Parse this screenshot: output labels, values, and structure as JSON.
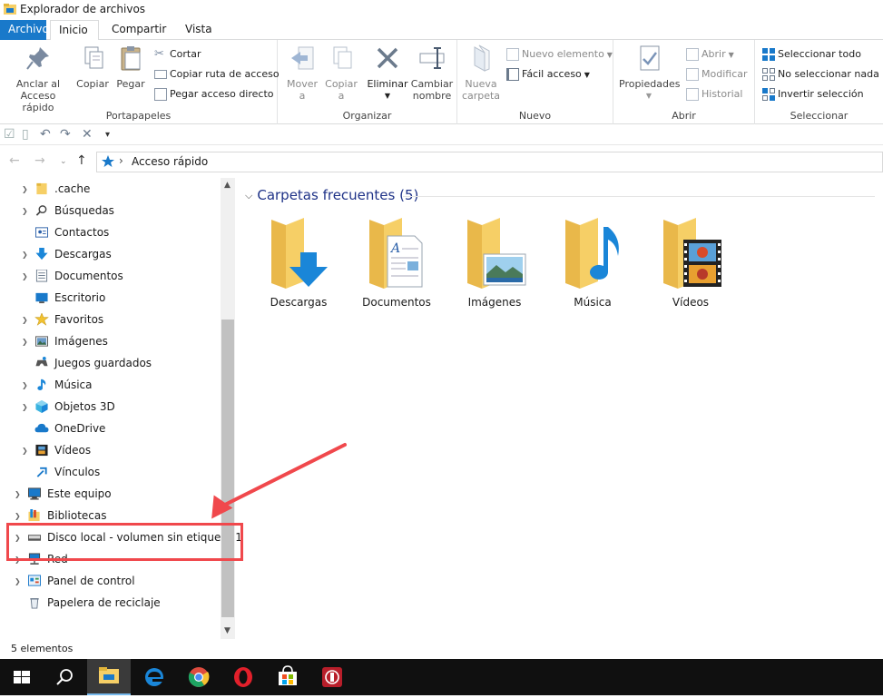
{
  "window": {
    "title": "Explorador de archivos"
  },
  "tabs": {
    "file": "Archivo",
    "home": "Inicio",
    "share": "Compartir",
    "view": "Vista"
  },
  "ribbon": {
    "portapapeles": {
      "label": "Portapapeles",
      "pin": "Anclar al\nAcceso rápido",
      "pin_l1": "Anclar al",
      "pin_l2": "Acceso rápido",
      "copy": "Copiar",
      "paste": "Pegar",
      "cut": "Cortar",
      "copy_path": "Copiar ruta de acceso",
      "paste_shortcut": "Pegar acceso directo"
    },
    "organizar": {
      "label": "Organizar",
      "move_l1": "Mover",
      "move_l2": "a",
      "copyto_l1": "Copiar",
      "copyto_l2": "a",
      "delete": "Eliminar",
      "rename_l1": "Cambiar",
      "rename_l2": "nombre"
    },
    "nuevo": {
      "label": "Nuevo",
      "new_folder_l1": "Nueva",
      "new_folder_l2": "carpeta",
      "new_item": "Nuevo elemento",
      "easy_access": "Fácil acceso"
    },
    "abrir": {
      "label": "Abrir",
      "properties": "Propiedades",
      "open": "Abrir",
      "edit": "Modificar",
      "history": "Historial"
    },
    "seleccionar": {
      "label": "Seleccionar",
      "select_all": "Seleccionar todo",
      "select_none": "No seleccionar nada",
      "invert": "Invertir selección"
    }
  },
  "address": {
    "crumb": "Acceso rápido"
  },
  "navpane": {
    "items": [
      {
        "label": ".cache"
      },
      {
        "label": "Búsquedas"
      },
      {
        "label": "Contactos"
      },
      {
        "label": "Descargas"
      },
      {
        "label": "Documentos"
      },
      {
        "label": "Escritorio"
      },
      {
        "label": "Favoritos"
      },
      {
        "label": "Imágenes"
      },
      {
        "label": "Juegos guardados"
      },
      {
        "label": "Música"
      },
      {
        "label": "Objetos 3D"
      },
      {
        "label": "OneDrive"
      },
      {
        "label": "Vídeos"
      },
      {
        "label": "Vínculos"
      },
      {
        "label": "Este equipo"
      },
      {
        "label": "Bibliotecas"
      },
      {
        "label": "Disco local - volumen sin etiqueta 1"
      },
      {
        "label": "Red"
      },
      {
        "label": "Panel de control"
      },
      {
        "label": "Papelera de reciclaje"
      }
    ]
  },
  "content": {
    "section_title": "Carpetas frecuentes (5)",
    "folders": [
      {
        "label": "Descargas",
        "icon": "download-folder-icon"
      },
      {
        "label": "Documentos",
        "icon": "documents-folder-icon"
      },
      {
        "label": "Imágenes",
        "icon": "pictures-folder-icon"
      },
      {
        "label": "Música",
        "icon": "music-folder-icon"
      },
      {
        "label": "Vídeos",
        "icon": "videos-folder-icon"
      }
    ]
  },
  "status": {
    "count": "5 elementos"
  },
  "colors": {
    "accent": "#1979ca",
    "folder": "#f6cf66",
    "annotation": "#f0484c",
    "taskbar": "#101010"
  }
}
